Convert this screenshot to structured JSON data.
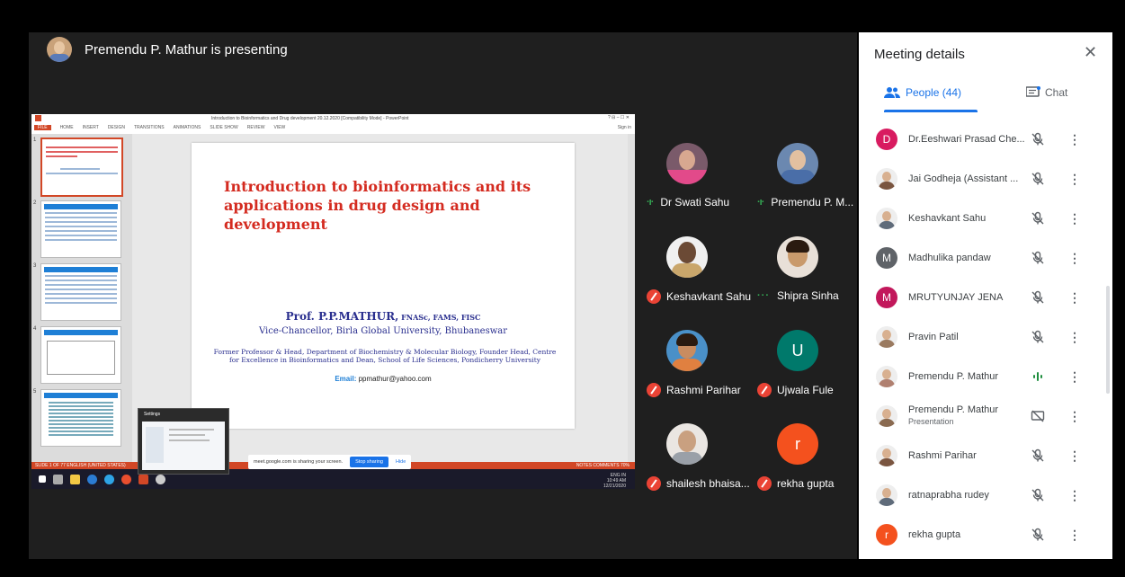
{
  "presenter": {
    "banner": "Premendu P. Mathur is presenting"
  },
  "ppt": {
    "window_title": "Introduction to Bioinformatics and Drug development 20.12.2020 [Compatibility Mode] - PowerPoint",
    "tabs": [
      "FILE",
      "HOME",
      "INSERT",
      "DESIGN",
      "TRANSITIONS",
      "ANIMATIONS",
      "SLIDE SHOW",
      "REVIEW",
      "VIEW"
    ],
    "sign_in": "Sign in",
    "thumb_numbers": [
      "1",
      "2",
      "3",
      "4",
      "5"
    ],
    "status_left": "SLIDE 1 OF 77   ENGLISH (UNITED STATES)",
    "status_right": "NOTES   COMMENTS   70%",
    "tray_lang": "ENG IN",
    "tray_time": "10:49 AM",
    "tray_date": "12/21/2020"
  },
  "slide": {
    "title": "Introduction to bioinformatics and its applications in drug design and development",
    "author": "Prof. P.P.MATHUR,",
    "author_suffix": " FNASc, FAMS, FISC",
    "role": "Vice-Chancellor, Birla Global University, Bhubaneswar",
    "former": "Former Professor & Head, Department of Biochemistry & Molecular Biology, Founder Head, Centre for Excellence in Bioinformatics and Dean, School of Life Sciences, Pondicherry University",
    "email_label": "Email:",
    "email": " ppmathur@yahoo.com"
  },
  "settings_popup": {
    "title": "Settings"
  },
  "share_banner": {
    "text": "meet.google.com is sharing your screen.",
    "stop": "Stop sharing",
    "hide": "Hide"
  },
  "tiles": [
    {
      "name": "Dr Swati Sahu",
      "state": "speaking"
    },
    {
      "name": "Premendu P. M...",
      "state": "speaking"
    },
    {
      "name": "Keshavkant Sahu",
      "state": "muted"
    },
    {
      "name": "Shipra Sinha",
      "state": "dots"
    },
    {
      "name": "Rashmi Parihar",
      "state": "muted"
    },
    {
      "name": "Ujwala Fule",
      "state": "muted",
      "letter": "U"
    },
    {
      "name": "shailesh bhaisa...",
      "state": "muted"
    },
    {
      "name": "rekha gupta",
      "state": "muted",
      "letter": "r"
    }
  ],
  "panel": {
    "title": "Meeting details",
    "tab_people": "People (44)",
    "tab_chat": "Chat",
    "people": [
      {
        "name": "Dr.Eeshwari Prasad Che...",
        "letter": "D",
        "color": "#d81b60"
      },
      {
        "name": "Jai Godheja (Assistant ...",
        "photo": true
      },
      {
        "name": "Keshavkant Sahu",
        "photo": true
      },
      {
        "name": "Madhulika pandaw",
        "letter": "M",
        "color": "#5f6368"
      },
      {
        "name": "MRUTYUNJAY JENA",
        "letter": "M",
        "color": "#c2185b"
      },
      {
        "name": "Pravin Patil",
        "photo": true
      },
      {
        "name": "Premendu P. Mathur",
        "photo": true,
        "speaking": true
      },
      {
        "name": "Premendu P. Mathur",
        "sub": "Presentation",
        "photo": true,
        "presenting": true
      },
      {
        "name": "Rashmi Parihar",
        "photo": true
      },
      {
        "name": "ratnaprabha rudey",
        "photo": true
      },
      {
        "name": "rekha gupta",
        "letter": "r",
        "color": "#f4511e"
      }
    ]
  }
}
